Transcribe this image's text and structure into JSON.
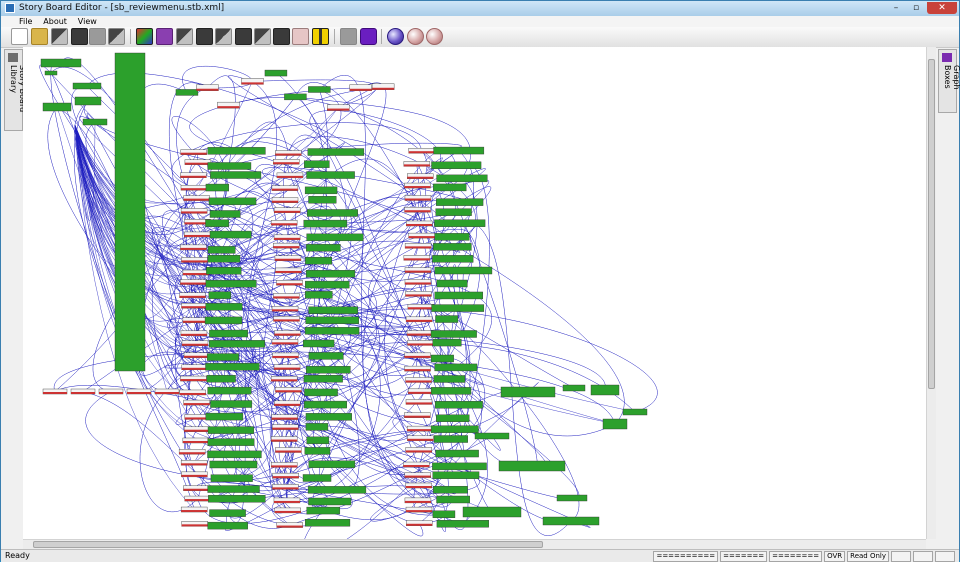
{
  "window": {
    "title": "Story Board Editor - [sb_reviewmenu.stb.xml]"
  },
  "titlebar": {
    "min": "–",
    "max": "▫",
    "close": "✕"
  },
  "menu": [
    "File",
    "About",
    "View"
  ],
  "toolbar_icons": [
    "new-document-icon",
    "open-folder-icon",
    "storyboard-icon",
    "storyboard-run-icon",
    "search-icon",
    "layout-icon",
    "cube-icon",
    "graph-box-icon",
    "state-icon",
    "scene-icon",
    "image-icon",
    "film-icon",
    "layer-icon",
    "box-icon",
    "yellow-bar-icon",
    "disk-icon",
    "purple-box-icon",
    "globe-icon",
    "pink-sphere-icon",
    "pink-sphere-2-icon"
  ],
  "side_panels": {
    "left": "Story Board Library",
    "right": "Graph Boxes"
  },
  "canvas": {
    "node_color": "#2ca02c",
    "edge_color": "#2020c0",
    "header_color": "#cc3333"
  },
  "statusbar": {
    "status": "Ready",
    "panes": [
      "==========",
      "=======",
      "========",
      "OVR",
      "Read Only"
    ]
  }
}
